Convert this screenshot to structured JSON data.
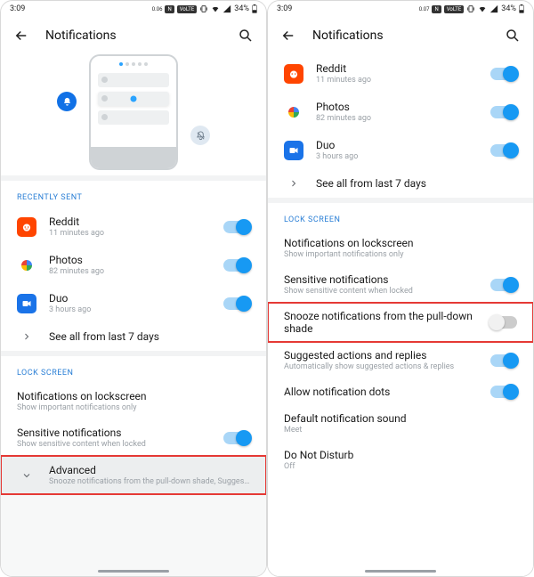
{
  "status": {
    "time": "3:09",
    "kbps": "0.06",
    "volte": "VoLTE",
    "n": "N",
    "battery": "34%"
  },
  "status2": {
    "time": "3:09",
    "kbps": "0.07",
    "volte": "VoLTE",
    "n": "N",
    "battery": "34%"
  },
  "header": {
    "title": "Notifications"
  },
  "left": {
    "section_recent": "RECENTLY SENT",
    "apps": [
      {
        "name": "Reddit",
        "sub": "11 minutes ago"
      },
      {
        "name": "Photos",
        "sub": "82 minutes ago"
      },
      {
        "name": "Duo",
        "sub": "3 hours ago"
      }
    ],
    "see_all": "See all from last 7 days",
    "section_lock": "LOCK SCREEN",
    "lock_rows": [
      {
        "t": "Notifications on lockscreen",
        "s": "Show important notifications only"
      },
      {
        "t": "Sensitive notifications",
        "s": "Show sensitive content when locked"
      }
    ],
    "advanced": {
      "t": "Advanced",
      "s": "Snooze notifications from the pull-down shade, Suggested action…"
    }
  },
  "right": {
    "apps": [
      {
        "name": "Reddit",
        "sub": "11 minutes ago"
      },
      {
        "name": "Photos",
        "sub": "82 minutes ago"
      },
      {
        "name": "Duo",
        "sub": "3 hours ago"
      }
    ],
    "see_all": "See all from last 7 days",
    "section_lock": "LOCK SCREEN",
    "rows": [
      {
        "t": "Notifications on lockscreen",
        "s": "Show important notifications only",
        "toggle": null
      },
      {
        "t": "Sensitive notifications",
        "s": "Show sensitive content when locked",
        "toggle": "on"
      },
      {
        "t": "Snooze notifications from the pull-down shade",
        "s": "",
        "toggle": "off",
        "hl": true
      },
      {
        "t": "Suggested actions and replies",
        "s": "Automatically show suggested actions & replies",
        "toggle": "on"
      },
      {
        "t": "Allow notification dots",
        "s": "",
        "toggle": "on"
      },
      {
        "t": "Default notification sound",
        "s": "Meet",
        "toggle": null
      },
      {
        "t": "Do Not Disturb",
        "s": "Off",
        "toggle": null
      }
    ]
  }
}
